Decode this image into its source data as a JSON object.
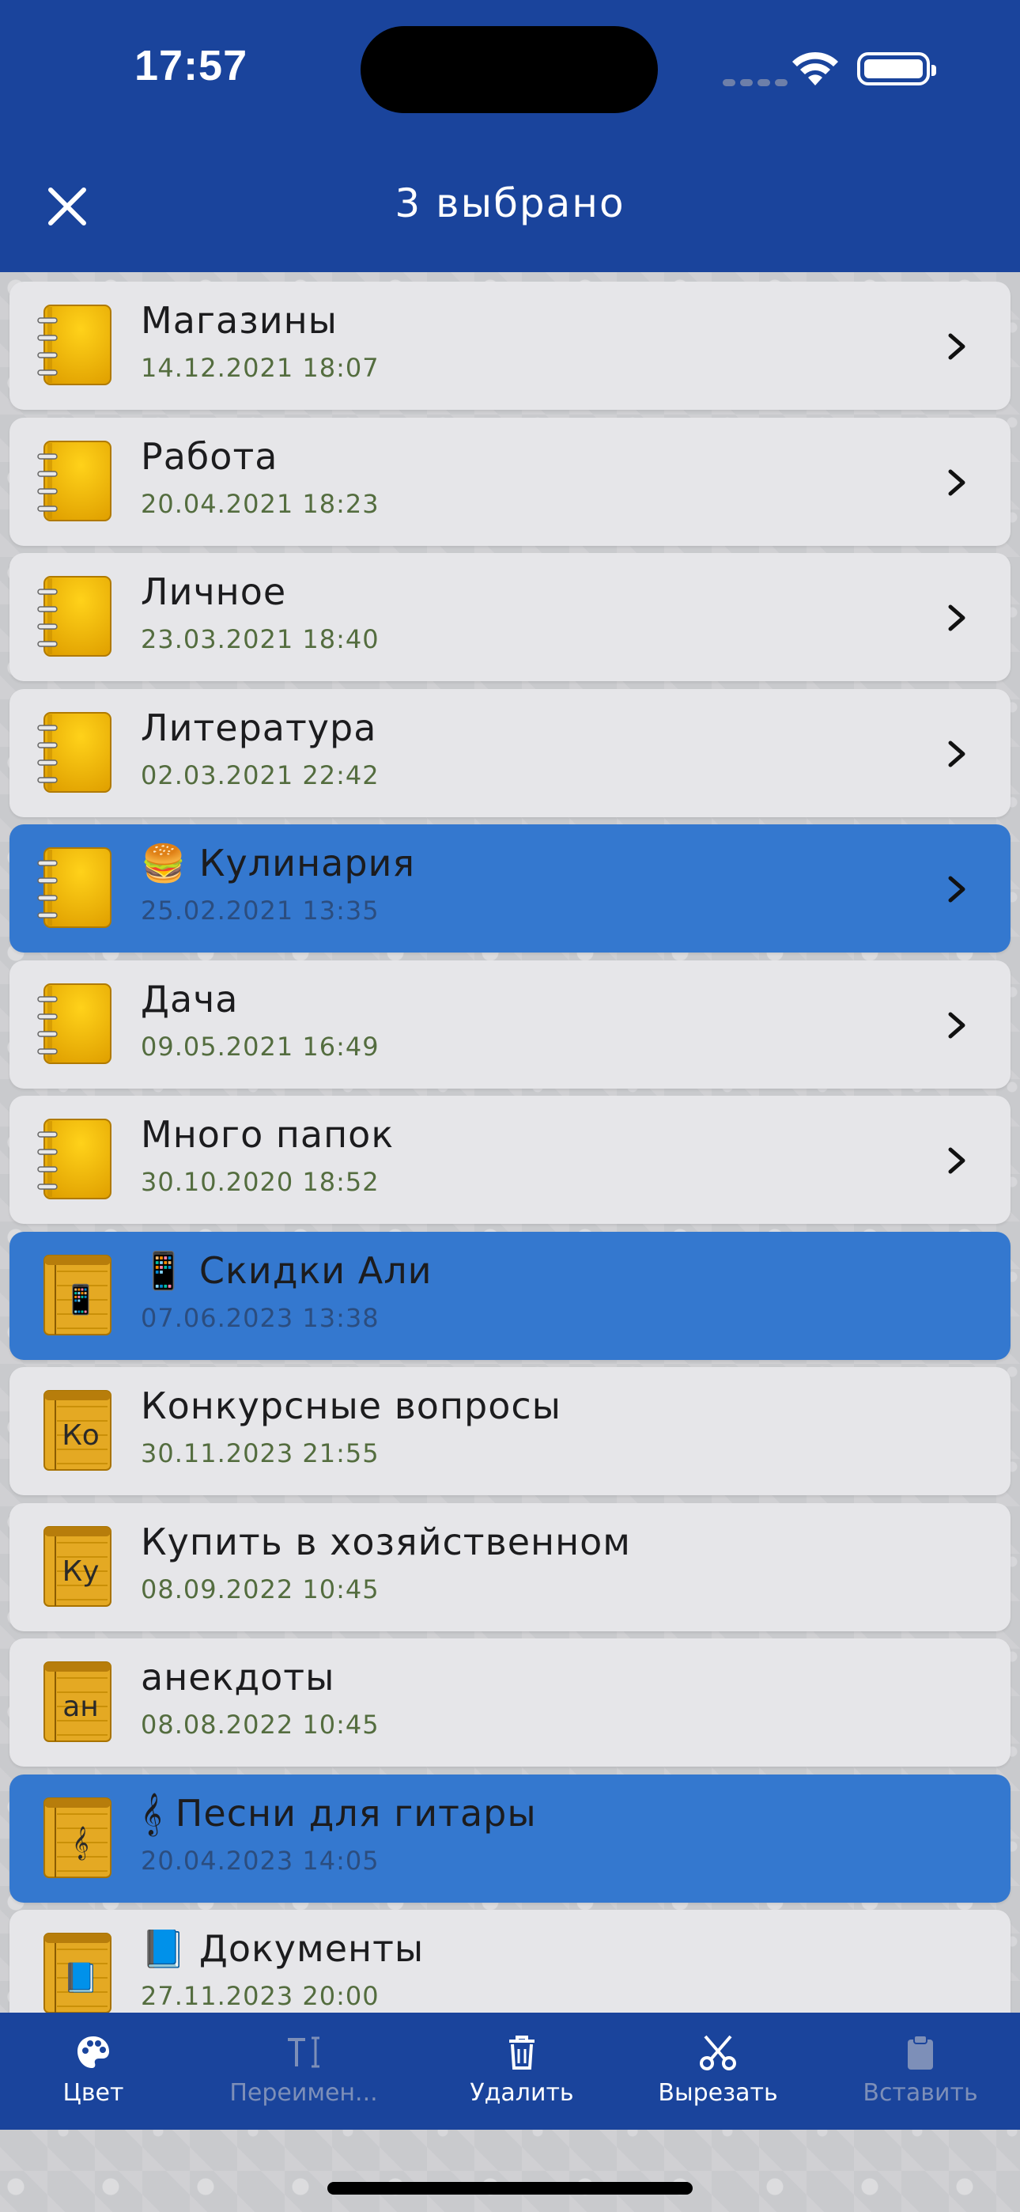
{
  "status_bar": {
    "time": "17:57"
  },
  "header": {
    "title": "3 выбрано"
  },
  "colors": {
    "header": "#1a449c",
    "selected": "#3478cf",
    "row": "#e6e6e9",
    "date": "#546d3f"
  },
  "items": [
    {
      "name": "Магазины",
      "date": "14.12.2021 18:07",
      "kind": "folder",
      "selected": false
    },
    {
      "name": "Работа",
      "date": "20.04.2021 18:23",
      "kind": "folder",
      "selected": false
    },
    {
      "name": "Личное",
      "date": "23.03.2021 18:40",
      "kind": "folder",
      "selected": false
    },
    {
      "name": "Литература",
      "date": "02.03.2021 22:42",
      "kind": "folder",
      "selected": false
    },
    {
      "name": "🍔  Кулинария",
      "date": "25.02.2021 13:35",
      "kind": "folder",
      "selected": true
    },
    {
      "name": "Дача",
      "date": "09.05.2021 16:49",
      "kind": "folder",
      "selected": false
    },
    {
      "name": "Много папок",
      "date": "30.10.2020 18:52",
      "kind": "folder",
      "selected": false
    },
    {
      "name": "📱  Скидки Али",
      "date": "07.06.2023 13:38",
      "kind": "note",
      "badge": "📱",
      "selected": true
    },
    {
      "name": "Конкурсные вопросы",
      "date": "30.11.2023 21:55",
      "kind": "note",
      "badge": "Ко",
      "selected": false
    },
    {
      "name": "Купить в хозяйственном",
      "date": "08.09.2022 10:45",
      "kind": "note",
      "badge": "Ку",
      "selected": false
    },
    {
      "name": "анекдоты",
      "date": "08.08.2022 10:45",
      "kind": "note",
      "badge": "ан",
      "selected": false
    },
    {
      "name": "𝄞 Песни для гитары",
      "date": "20.04.2023 14:05",
      "kind": "note",
      "badge": "𝄞",
      "selected": true
    },
    {
      "name": "📘  Документы",
      "date": "27.11.2023 20:00",
      "kind": "note",
      "badge": "📘",
      "selected": false
    }
  ],
  "toolbar": {
    "color_label": "Цвет",
    "rename_label": "Переимен...",
    "delete_label": "Удалить",
    "cut_label": "Вырезать",
    "paste_label": "Вставить"
  }
}
